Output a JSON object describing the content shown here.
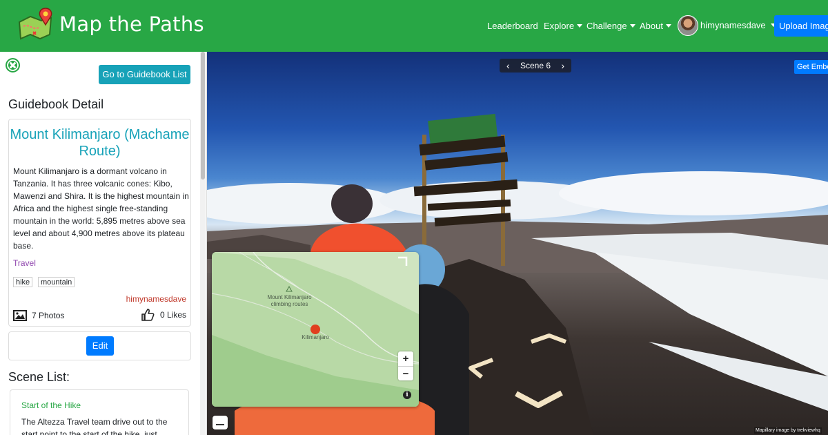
{
  "navbar": {
    "brand": "Map the Paths",
    "links": [
      {
        "label": "Leaderboard",
        "dropdown": false
      },
      {
        "label": "Explore",
        "dropdown": true
      },
      {
        "label": "Challenge",
        "dropdown": true
      },
      {
        "label": "About",
        "dropdown": true
      }
    ],
    "username": "himynamesdave",
    "upload_label": "Upload Image",
    "colors": {
      "bar": "#28a745",
      "upload": "#007bff"
    }
  },
  "sidebar": {
    "goto_list_label": "Go to Guidebook List",
    "detail_heading": "Guidebook Detail",
    "guidebook": {
      "title": "Mount Kilimanjaro (Machame Route)",
      "description": "Mount Kilimanjaro is a dormant volcano in Tanzania. It has three volcanic cones: Kibo, Mawenzi and Shira. It is the highest mountain in Africa and the highest single free-standing mountain in the world: 5,895 metres above sea level and about 4,900 metres above its plateau base.",
      "category": "Travel",
      "tags": [
        "hike",
        "mountain"
      ],
      "author": "himynamesdave",
      "photos": "7 Photos",
      "likes": "0 Likes"
    },
    "edit_label": "Edit",
    "scene_list_heading": "Scene List:",
    "scenes": [
      {
        "title": "Start of the Hike",
        "description": "The Altezza Travel team drive out to the start point to the start of the hike, just"
      }
    ]
  },
  "viewer": {
    "scene_label": "Scene 6",
    "embed_label": "Get Embed",
    "map": {
      "peak_label": "Mount Kilimanjaro climbing routes",
      "marker_label": "Kilimanjaro",
      "marker_color": "#e0401f"
    },
    "zoom_in": "+",
    "zoom_out": "−",
    "info": "i",
    "attribution": "Mapillary   image by trekviewhq"
  }
}
